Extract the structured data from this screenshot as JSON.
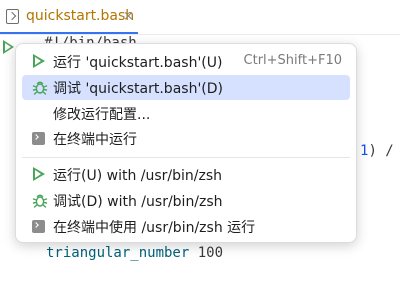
{
  "tab": {
    "filename": "quickstart.bash",
    "close": "×"
  },
  "editor": {
    "top_line": "#!/bin/bash",
    "fragment_num": "1",
    "fragment_op": ") /",
    "bottom_fn": "triangular_number",
    "bottom_arg": " 100"
  },
  "menu": {
    "items": [
      {
        "label": "运行 'quickstart.bash'(U)",
        "shortcut": "Ctrl+Shift+F10",
        "icon": "run-icon"
      },
      {
        "label": "调试 'quickstart.bash'(D)",
        "icon": "debug-icon"
      },
      {
        "label": "修改运行配置..."
      },
      {
        "label": "在终端中运行",
        "icon": "terminal-icon"
      },
      {
        "label": "运行(U) with /usr/bin/zsh",
        "icon": "run-icon"
      },
      {
        "label": "调试(D) with /usr/bin/zsh",
        "icon": "debug-icon"
      },
      {
        "label": "在终端中使用 /usr/bin/zsh 运行",
        "icon": "terminal-icon"
      }
    ]
  },
  "colors": {
    "accent": "#3574f0",
    "selection": "#d5e1ff",
    "run_green": "#4aa55a",
    "tab_text": "#b47400"
  }
}
